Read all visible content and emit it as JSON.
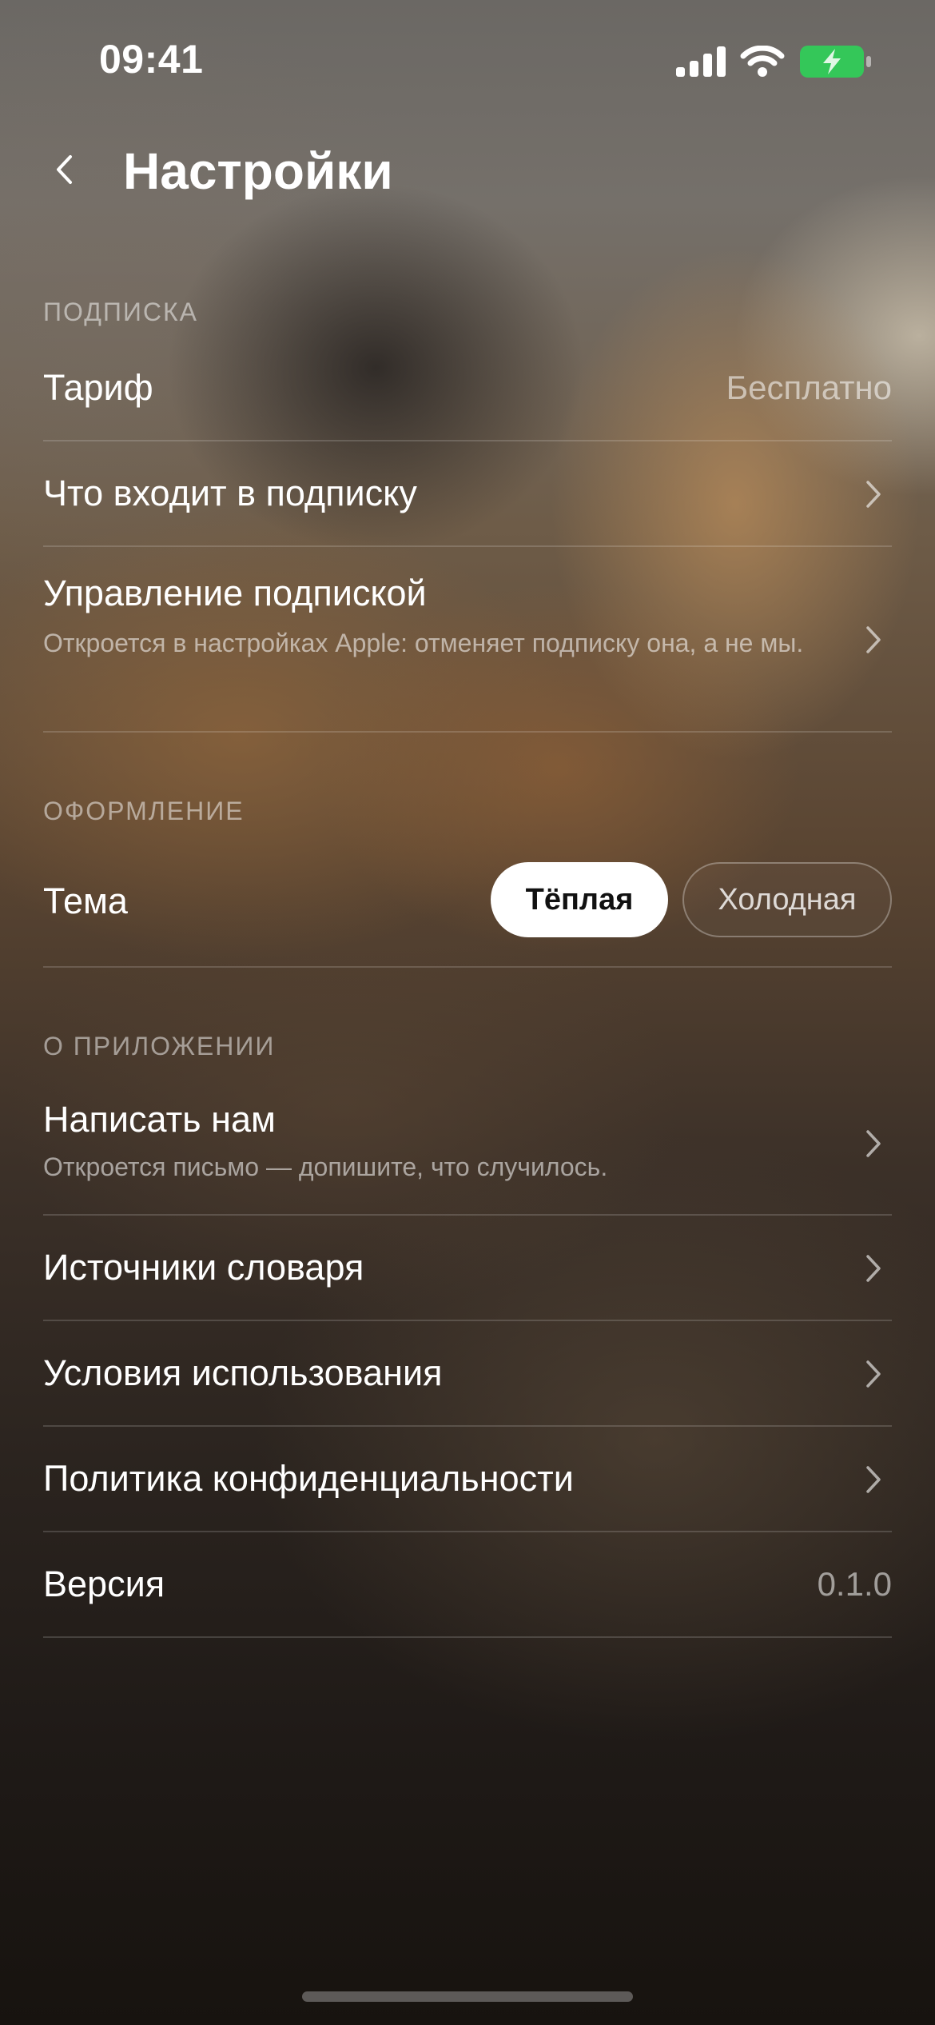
{
  "status_bar": {
    "time": "09:41"
  },
  "header": {
    "title": "Настройки",
    "back_icon": "chevron-left-icon"
  },
  "sections": {
    "subscription": {
      "header": "ПОДПИСКА",
      "tariff_label": "Тариф",
      "tariff_value": "Бесплатно",
      "included_label": "Что входит в подписку",
      "manage_label": "Управление подпиской",
      "manage_sub": "Откроется в настройках Apple: отменяет подписку она, а не мы."
    },
    "appearance": {
      "header": "ОФОРМЛЕНИЕ",
      "theme_label": "Тема",
      "theme_options": [
        "Тёплая",
        "Холодная"
      ],
      "theme_selected": "Тёплая"
    },
    "about": {
      "header": "О ПРИЛОЖЕНИИ",
      "contact_label": "Написать нам",
      "contact_sub": "Откроется письмо — допишите, что случилось.",
      "dictionary_label": "Источники словаря",
      "terms_label": "Условия использования",
      "privacy_label": "Политика конфиденциальности",
      "version_label": "Версия",
      "version_value": "0.1.0"
    }
  },
  "colors": {
    "battery_fill": "#34c759",
    "text_primary": "#ffffff",
    "selected_pill_bg": "#ffffff",
    "selected_pill_text": "#111111"
  }
}
